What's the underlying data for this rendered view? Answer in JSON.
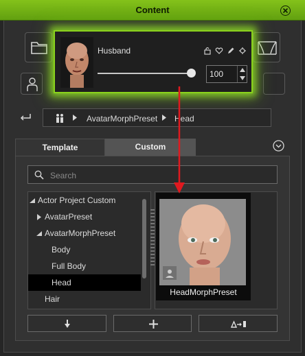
{
  "window": {
    "title": "Content"
  },
  "popup": {
    "name": "Husband",
    "value": "100"
  },
  "breadcrumb": {
    "items": [
      "AvatarMorphPreset",
      "Head"
    ]
  },
  "tabs": [
    {
      "label": "Template"
    },
    {
      "label": "Custom"
    }
  ],
  "search": {
    "placeholder": "Search"
  },
  "tree": {
    "items": [
      {
        "label": "Actor Project Custom"
      },
      {
        "label": "AvatarPreset"
      },
      {
        "label": "AvatarMorphPreset"
      },
      {
        "label": "Body"
      },
      {
        "label": "Full Body"
      },
      {
        "label": "Head",
        "selected": true
      },
      {
        "label": "Hair"
      }
    ]
  },
  "content": {
    "items": [
      {
        "label": "HeadMorphPreset"
      }
    ]
  },
  "colors": {
    "accent": "#8ad21c",
    "arrow": "#e0191f",
    "selected": "#000000"
  },
  "icons": [
    "close-icon",
    "folder-icon",
    "stage-icon",
    "person-icon",
    "back-icon",
    "people-icon",
    "lock-icon",
    "heart-icon",
    "pencil-icon",
    "gear-icon",
    "search-icon",
    "arrow-down-icon",
    "plus-icon",
    "convert-icon"
  ]
}
